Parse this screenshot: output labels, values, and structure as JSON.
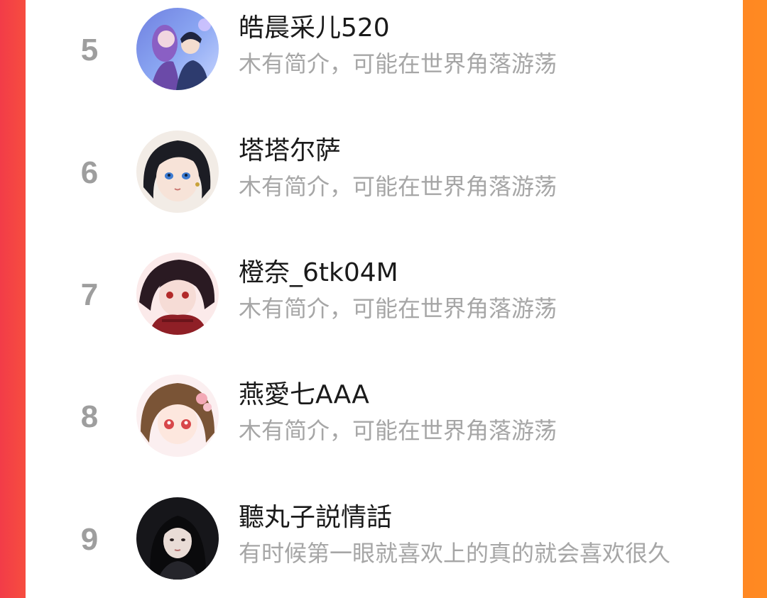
{
  "ranking": {
    "items": [
      {
        "rank": "5",
        "name": "皓晨采儿520",
        "bio": "木有简介，可能在世界角落游荡"
      },
      {
        "rank": "6",
        "name": "塔塔尔萨",
        "bio": "木有简介，可能在世界角落游荡"
      },
      {
        "rank": "7",
        "name": "橙奈_6tk04M",
        "bio": "木有简介，可能在世界角落游荡"
      },
      {
        "rank": "8",
        "name": "燕愛七AAA",
        "bio": "木有简介，可能在世界角落游荡"
      },
      {
        "rank": "9",
        "name": "聽丸子説情話",
        "bio": "有时候第一眼就喜欢上的真的就会喜欢很久"
      }
    ]
  },
  "colors": {
    "background_left": "#f23c48",
    "background_right": "#ff8a22",
    "panel": "#ffffff",
    "rank_text": "#9e9e9e",
    "name_text": "#1a1a1a",
    "bio_text": "#a6a6a6"
  }
}
